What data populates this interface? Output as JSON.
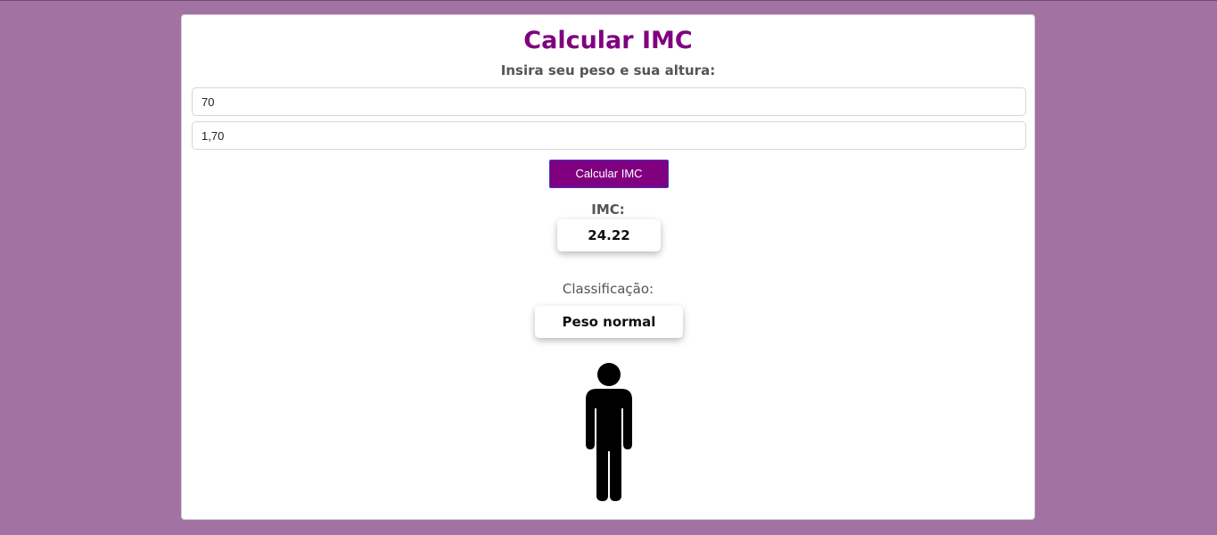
{
  "page": {
    "title": "Calcular IMC",
    "subtitle": "Insira seu peso e sua altura:"
  },
  "form": {
    "weight_value": "70",
    "height_value": "1,70",
    "submit_label": "Calcular IMC"
  },
  "result": {
    "imc_label": "IMC:",
    "imc_value": "24.22",
    "classification_label": "Classificação:",
    "classification_value": "Peso normal",
    "figure_icon": "person-standing-icon"
  },
  "colors": {
    "background": "#a273a2",
    "accent": "#800080",
    "card": "#ffffff"
  }
}
